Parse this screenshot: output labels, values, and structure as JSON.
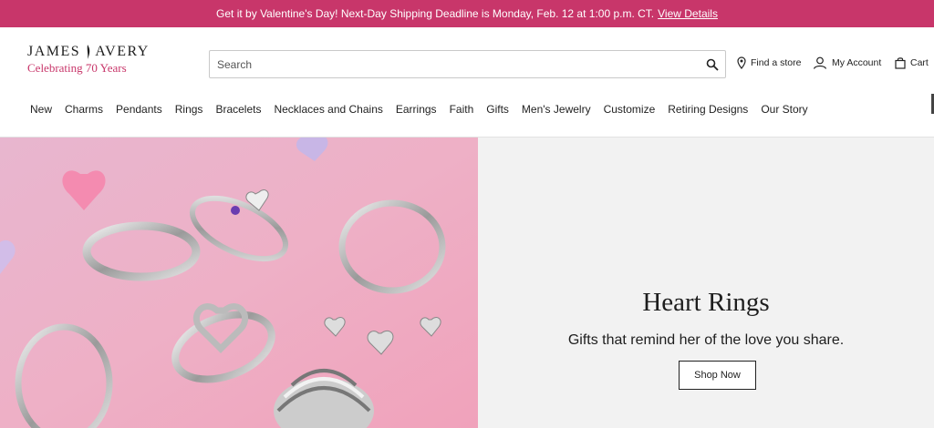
{
  "promo": {
    "message": "Get it by Valentine's Day! Next-Day Shipping Deadline is Monday, Feb. 12 at 1:00 p.m. CT.",
    "link_label": "View Details"
  },
  "logo": {
    "wordmark_left": "JAMES",
    "wordmark_right": "AVERY",
    "tagline": "Celebrating 70 Years"
  },
  "search": {
    "placeholder": "Search",
    "value": ""
  },
  "utility": {
    "find_store": "Find a store",
    "account": "My Account",
    "cart": "Cart"
  },
  "nav": {
    "items": [
      "New",
      "Charms",
      "Pendants",
      "Rings",
      "Bracelets",
      "Necklaces and Chains",
      "Earrings",
      "Faith",
      "Gifts",
      "Men's Jewelry",
      "Customize",
      "Retiring Designs",
      "Our Story"
    ]
  },
  "hero": {
    "title": "Heart Rings",
    "subtitle": "Gifts that remind her of the love you share.",
    "button": "Shop Now"
  },
  "colors": {
    "brand": "#c8366a",
    "panel": "#f2f2f2"
  }
}
